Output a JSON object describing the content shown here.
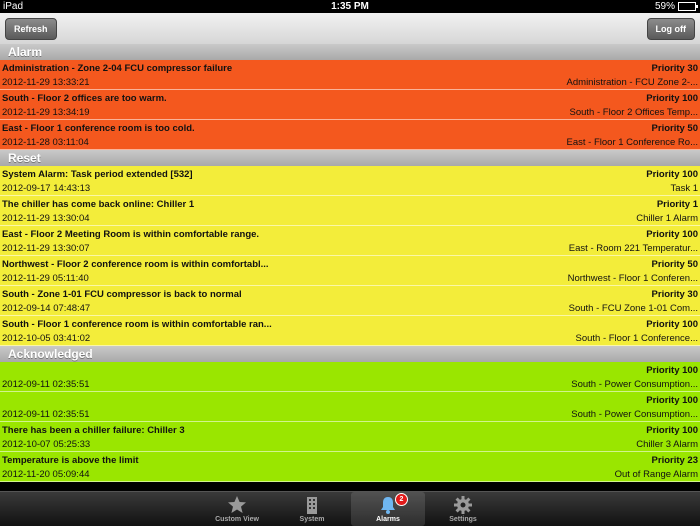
{
  "status_bar": {
    "device": "iPad",
    "time": "1:35 PM",
    "battery": "59%",
    "battery_level": 0.59
  },
  "toolbar": {
    "refresh_label": "Refresh",
    "logoff_label": "Log off"
  },
  "sections": [
    {
      "title": "Alarm",
      "rows": [
        {
          "message": "Administration - Zone 2-04 FCU compressor failure",
          "timestamp": "2012-11-29 13:33:21",
          "priority": "Priority  30",
          "source": "Administration - FCU Zone 2-..."
        },
        {
          "message": "South - Floor 2 offices are too warm.",
          "timestamp": "2012-11-29 13:34:19",
          "priority": "Priority  100",
          "source": "South - Floor 2 Offices Temp..."
        },
        {
          "message": "East - Floor 1 conference room is too cold.",
          "timestamp": "2012-11-28 03:11:04",
          "priority": "Priority  50",
          "source": "East - Floor 1 Conference Ro..."
        }
      ]
    },
    {
      "title": "Reset",
      "rows": [
        {
          "message": "System Alarm: Task period extended [532]",
          "timestamp": "2012-09-17 14:43:13",
          "priority": "Priority  100",
          "source": "Task 1"
        },
        {
          "message": "The chiller has come back online: Chiller 1",
          "timestamp": "2012-11-29 13:30:04",
          "priority": "Priority  1",
          "source": "Chiller 1 Alarm"
        },
        {
          "message": "East - Floor 2 Meeting Room is within comfortable range.",
          "timestamp": "2012-11-29 13:30:07",
          "priority": "Priority  100",
          "source": "East - Room 221 Temperatur..."
        },
        {
          "message": "Northwest - Floor 2 conference room is within comfortabl...",
          "timestamp": "2012-11-29 05:11:40",
          "priority": "Priority  50",
          "source": "Northwest - Floor 1 Conferen..."
        },
        {
          "message": "South - Zone 1-01 FCU compressor is back to normal",
          "timestamp": "2012-09-14 07:48:47",
          "priority": "Priority  30",
          "source": "South - FCU Zone 1-01 Com..."
        },
        {
          "message": "South - Floor 1 conference room is within comfortable ran...",
          "timestamp": "2012-10-05 03:41:02",
          "priority": "Priority  100",
          "source": "South - Floor 1 Conference..."
        }
      ]
    },
    {
      "title": "Acknowledged",
      "rows": [
        {
          "message": "",
          "timestamp": "2012-09-11 02:35:51",
          "priority": "Priority  100",
          "source": "South - Power Consumption..."
        },
        {
          "message": "",
          "timestamp": "2012-09-11 02:35:51",
          "priority": "Priority  100",
          "source": "South - Power Consumption..."
        },
        {
          "message": "There has been a chiller failure: Chiller 3",
          "timestamp": "2012-10-07 05:25:33",
          "priority": "Priority  100",
          "source": "Chiller 3 Alarm"
        },
        {
          "message": "Temperature is above the limit",
          "timestamp": "2012-11-20 05:09:44",
          "priority": "Priority  23",
          "source": "Out of Range Alarm"
        }
      ]
    }
  ],
  "tabs": [
    {
      "label": "Custom View",
      "icon": "star-icon"
    },
    {
      "label": "System",
      "icon": "building-icon"
    },
    {
      "label": "Alarms",
      "icon": "alarm-bell-icon",
      "badge": "2",
      "active": true
    },
    {
      "label": "Settings",
      "icon": "gear-icon"
    }
  ],
  "colors": {
    "alarm": "#f4581e",
    "reset": "#f3ed3a",
    "acknowledged": "#9ae600",
    "badge": "#e21b1b"
  }
}
